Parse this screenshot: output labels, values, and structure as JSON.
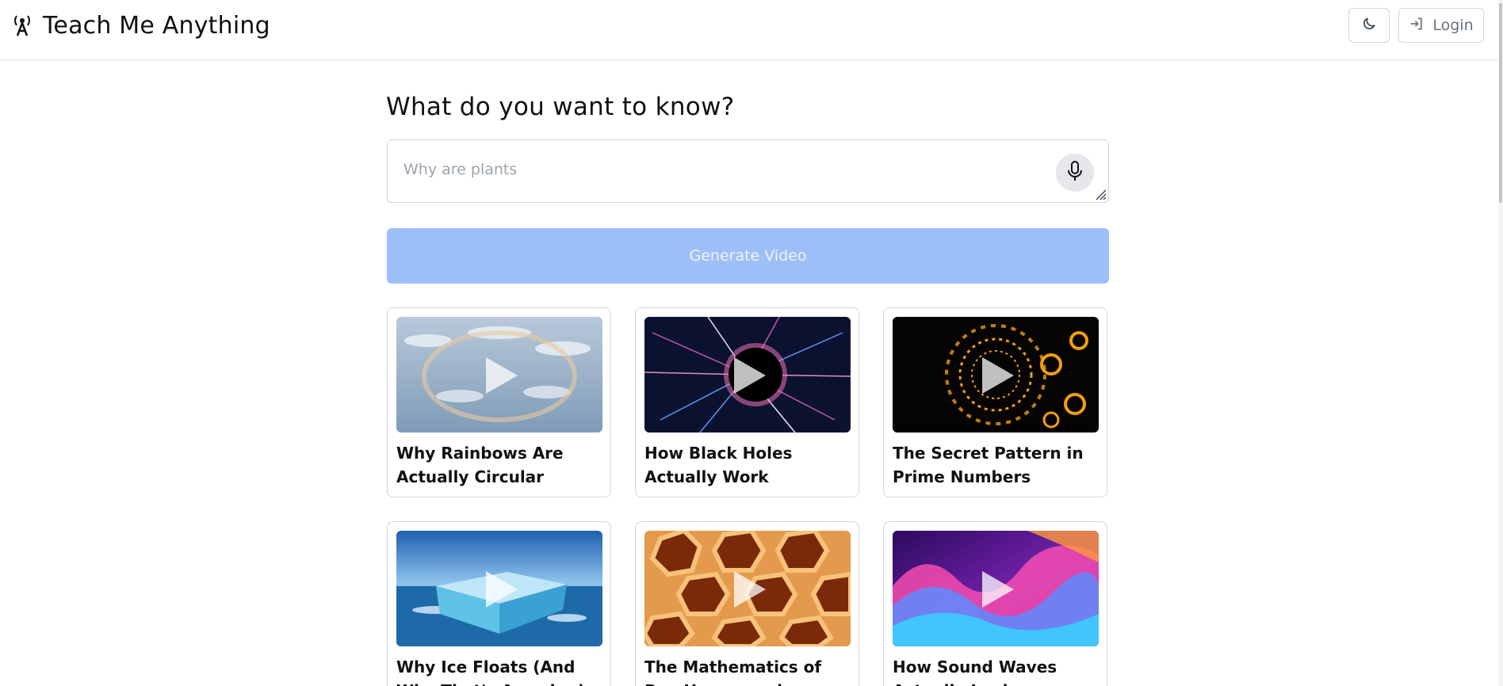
{
  "header": {
    "app_title": "Teach Me Anything",
    "login_label": "Login"
  },
  "main": {
    "heading": "What do you want to know?",
    "prompt_value": "Why are plants",
    "generate_label": "Generate Video"
  },
  "videos": [
    {
      "title": "Why Rainbows Are Actually Circular"
    },
    {
      "title": "How Black Holes Actually Work"
    },
    {
      "title": "The Secret Pattern in Prime Numbers"
    },
    {
      "title": "Why Ice Floats (And Why That's Amazing)"
    },
    {
      "title": "The Mathematics of Bee Honeycombs"
    },
    {
      "title": "How Sound Waves Actually Look"
    }
  ],
  "colors": {
    "generate_button": "#9dbff7",
    "border": "#d1d5db",
    "accent_orange": "#f59e0b"
  },
  "icons": [
    "antenna-icon",
    "moon-icon",
    "login-icon",
    "microphone-icon",
    "play-icon"
  ]
}
